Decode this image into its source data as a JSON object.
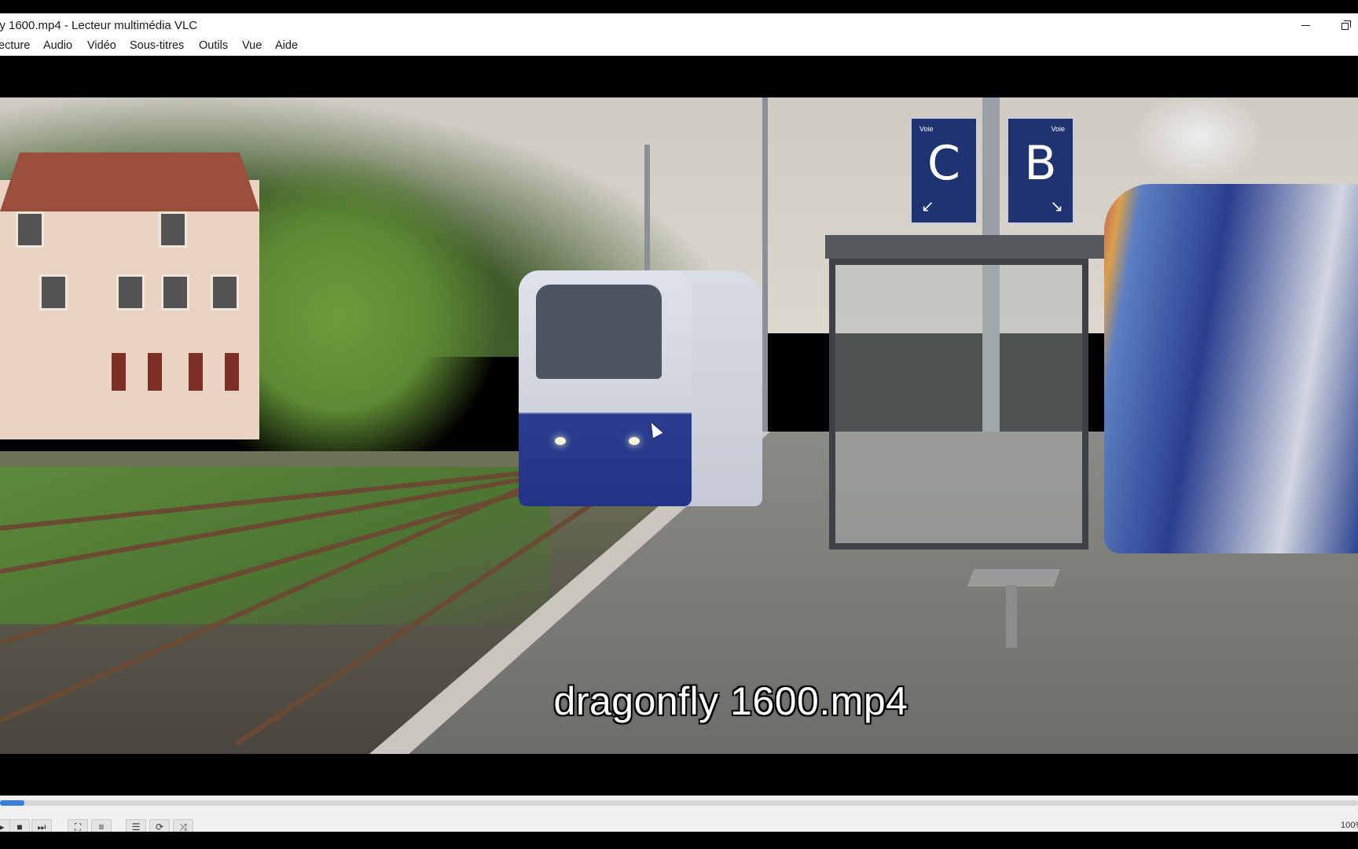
{
  "window": {
    "title": "ly 1600.mp4 - Lecteur multimédia VLC"
  },
  "menu": {
    "items": [
      "ecture",
      "Audio",
      "Vidéo",
      "Sous-titres",
      "Outils",
      "Vue",
      "Aide"
    ]
  },
  "video": {
    "overlay_title": "dragonfly 1600.mp4",
    "signs": [
      {
        "label": "Voie",
        "letter": "C",
        "arrow": "↙"
      },
      {
        "label": "Voie",
        "letter": "B",
        "arrow": "↘"
      }
    ]
  },
  "playback": {
    "progress": 0.018,
    "volume_label": "100%"
  },
  "controls": {
    "icons": [
      "play-icon",
      "stop-icon",
      "next-icon",
      "fullscreen-icon",
      "extended-settings-icon",
      "playlist-icon",
      "loop-icon",
      "shuffle-icon"
    ],
    "glyphs": [
      "▶",
      "■",
      "⏭",
      "⛶",
      "≡",
      "☰",
      "⟳",
      "⤨"
    ]
  },
  "colors": {
    "accent": "#3b7fd6",
    "sign_blue": "#1f3371"
  }
}
